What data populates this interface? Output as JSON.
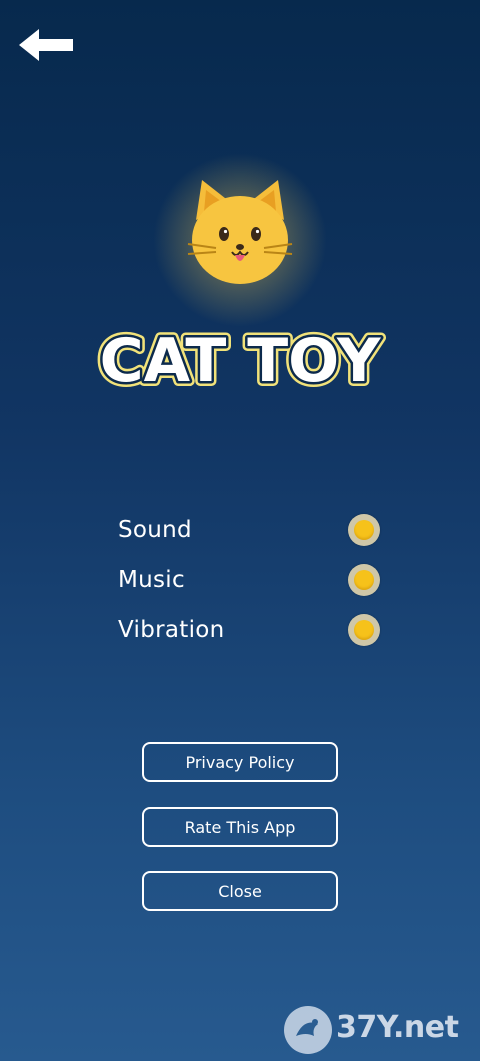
{
  "header": {
    "back_icon": "arrow-left-icon"
  },
  "hero": {
    "cat_icon": "cat-face-icon",
    "logo_text": "CAT TOY"
  },
  "settings": [
    {
      "label": "Sound",
      "enabled": true
    },
    {
      "label": "Music",
      "enabled": true
    },
    {
      "label": "Vibration",
      "enabled": true
    }
  ],
  "buttons": {
    "privacy": "Privacy Policy",
    "rate": "Rate This App",
    "close": "Close"
  },
  "watermark": {
    "text": "37Y.net"
  },
  "colors": {
    "background_top": "#07294d",
    "background_bottom": "#275a8f",
    "toggle_on": "#f6c21a",
    "toggle_ring": "#cfc7a8",
    "logo_fill": "#ffffff",
    "logo_outline": "#f1e27a"
  }
}
